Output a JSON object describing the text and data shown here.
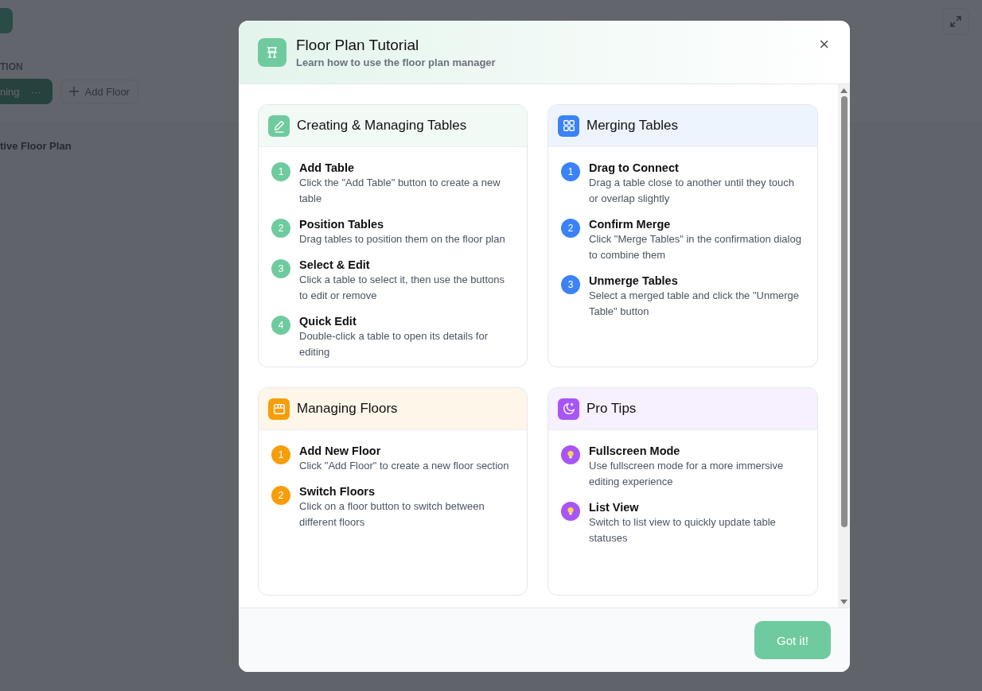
{
  "background": {
    "section_label": "TION",
    "floor_button": {
      "label": "ning",
      "menu": "···"
    },
    "add_floor": "Add Floor",
    "plan_title": "tive Floor Plan"
  },
  "dialog": {
    "title": "Floor Plan Tutorial",
    "subtitle": "Learn how to use the floor plan manager",
    "close": "×",
    "cards": [
      {
        "title": "Creating & Managing Tables",
        "color": "#6fcb9f",
        "items": [
          {
            "kind": "step",
            "marker": "1",
            "title": "Add Table",
            "text": "Click the \"Add Table\" button to create a new table"
          },
          {
            "kind": "step",
            "marker": "2",
            "title": "Position Tables",
            "text": "Drag tables to position them on the floor plan"
          },
          {
            "kind": "step",
            "marker": "3",
            "title": "Select & Edit",
            "text": "Click a table to select it, then use the buttons to edit or remove"
          },
          {
            "kind": "step",
            "marker": "4",
            "title": "Quick Edit",
            "text": "Double-click a table to open its details for editing"
          }
        ]
      },
      {
        "title": "Merging Tables",
        "color": "#3b82f6",
        "items": [
          {
            "kind": "step",
            "marker": "1",
            "title": "Drag to Connect",
            "text": "Drag a table close to another until they touch or overlap slightly"
          },
          {
            "kind": "step",
            "marker": "2",
            "title": "Confirm Merge",
            "text": "Click \"Merge Tables\" in the confirmation dialog to combine them"
          },
          {
            "kind": "step",
            "marker": "3",
            "title": "Unmerge Tables",
            "text": "Select a merged table and click the \"Unmerge Table\" button"
          }
        ]
      },
      {
        "title": "Managing Floors",
        "color": "#f59e0b",
        "items": [
          {
            "kind": "step",
            "marker": "1",
            "title": "Add New Floor",
            "text": "Click \"Add Floor\" to create a new floor section"
          },
          {
            "kind": "step",
            "marker": "2",
            "title": "Switch Floors",
            "text": "Click on a floor button to switch between different floors"
          }
        ]
      },
      {
        "title": "Pro Tips",
        "color": "#a855f7",
        "items": [
          {
            "kind": "tip",
            "title": "Fullscreen Mode",
            "text": "Use fullscreen mode for a more immersive editing experience"
          },
          {
            "kind": "tip",
            "title": "List View",
            "text": "Switch to list view to quickly update table statuses"
          }
        ]
      }
    ],
    "button": "Got it!"
  }
}
